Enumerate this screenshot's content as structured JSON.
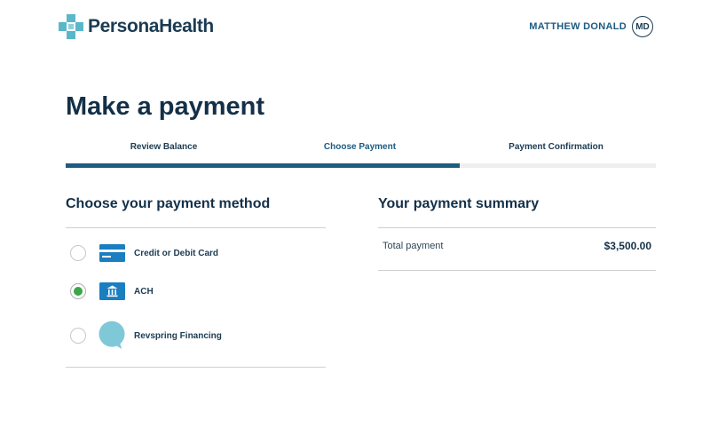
{
  "header": {
    "logo_text": "PersonaHealth",
    "user_name": "MATTHEW DONALD",
    "user_initials": "MD"
  },
  "page": {
    "title": "Make a payment"
  },
  "steps": {
    "items": [
      {
        "label": "Review Balance"
      },
      {
        "label": "Choose Payment"
      },
      {
        "label": "Payment Confirmation"
      }
    ],
    "active_index": 1,
    "progress_fraction": 0.667
  },
  "payment_methods": {
    "title": "Choose your payment method",
    "selected": "ACH",
    "items": [
      {
        "label": "Credit or Debit Card",
        "icon": "credit-card-icon",
        "checked": false
      },
      {
        "label": "ACH",
        "icon": "bank-icon",
        "checked": true
      },
      {
        "label": "Revspring Financing",
        "icon": "chat-bubble-icon",
        "checked": false
      }
    ]
  },
  "summary": {
    "title": "Your payment summary",
    "total_label": "Total payment",
    "total_value": "$3,500.00"
  },
  "colors": {
    "brand_navy": "#143048",
    "accent_blue": "#1c5b82",
    "logo_teal": "#5ab7c9",
    "card_blue": "#1b7ec0",
    "radio_green": "#3ca64a",
    "bubble_teal": "#7fc8d8"
  }
}
